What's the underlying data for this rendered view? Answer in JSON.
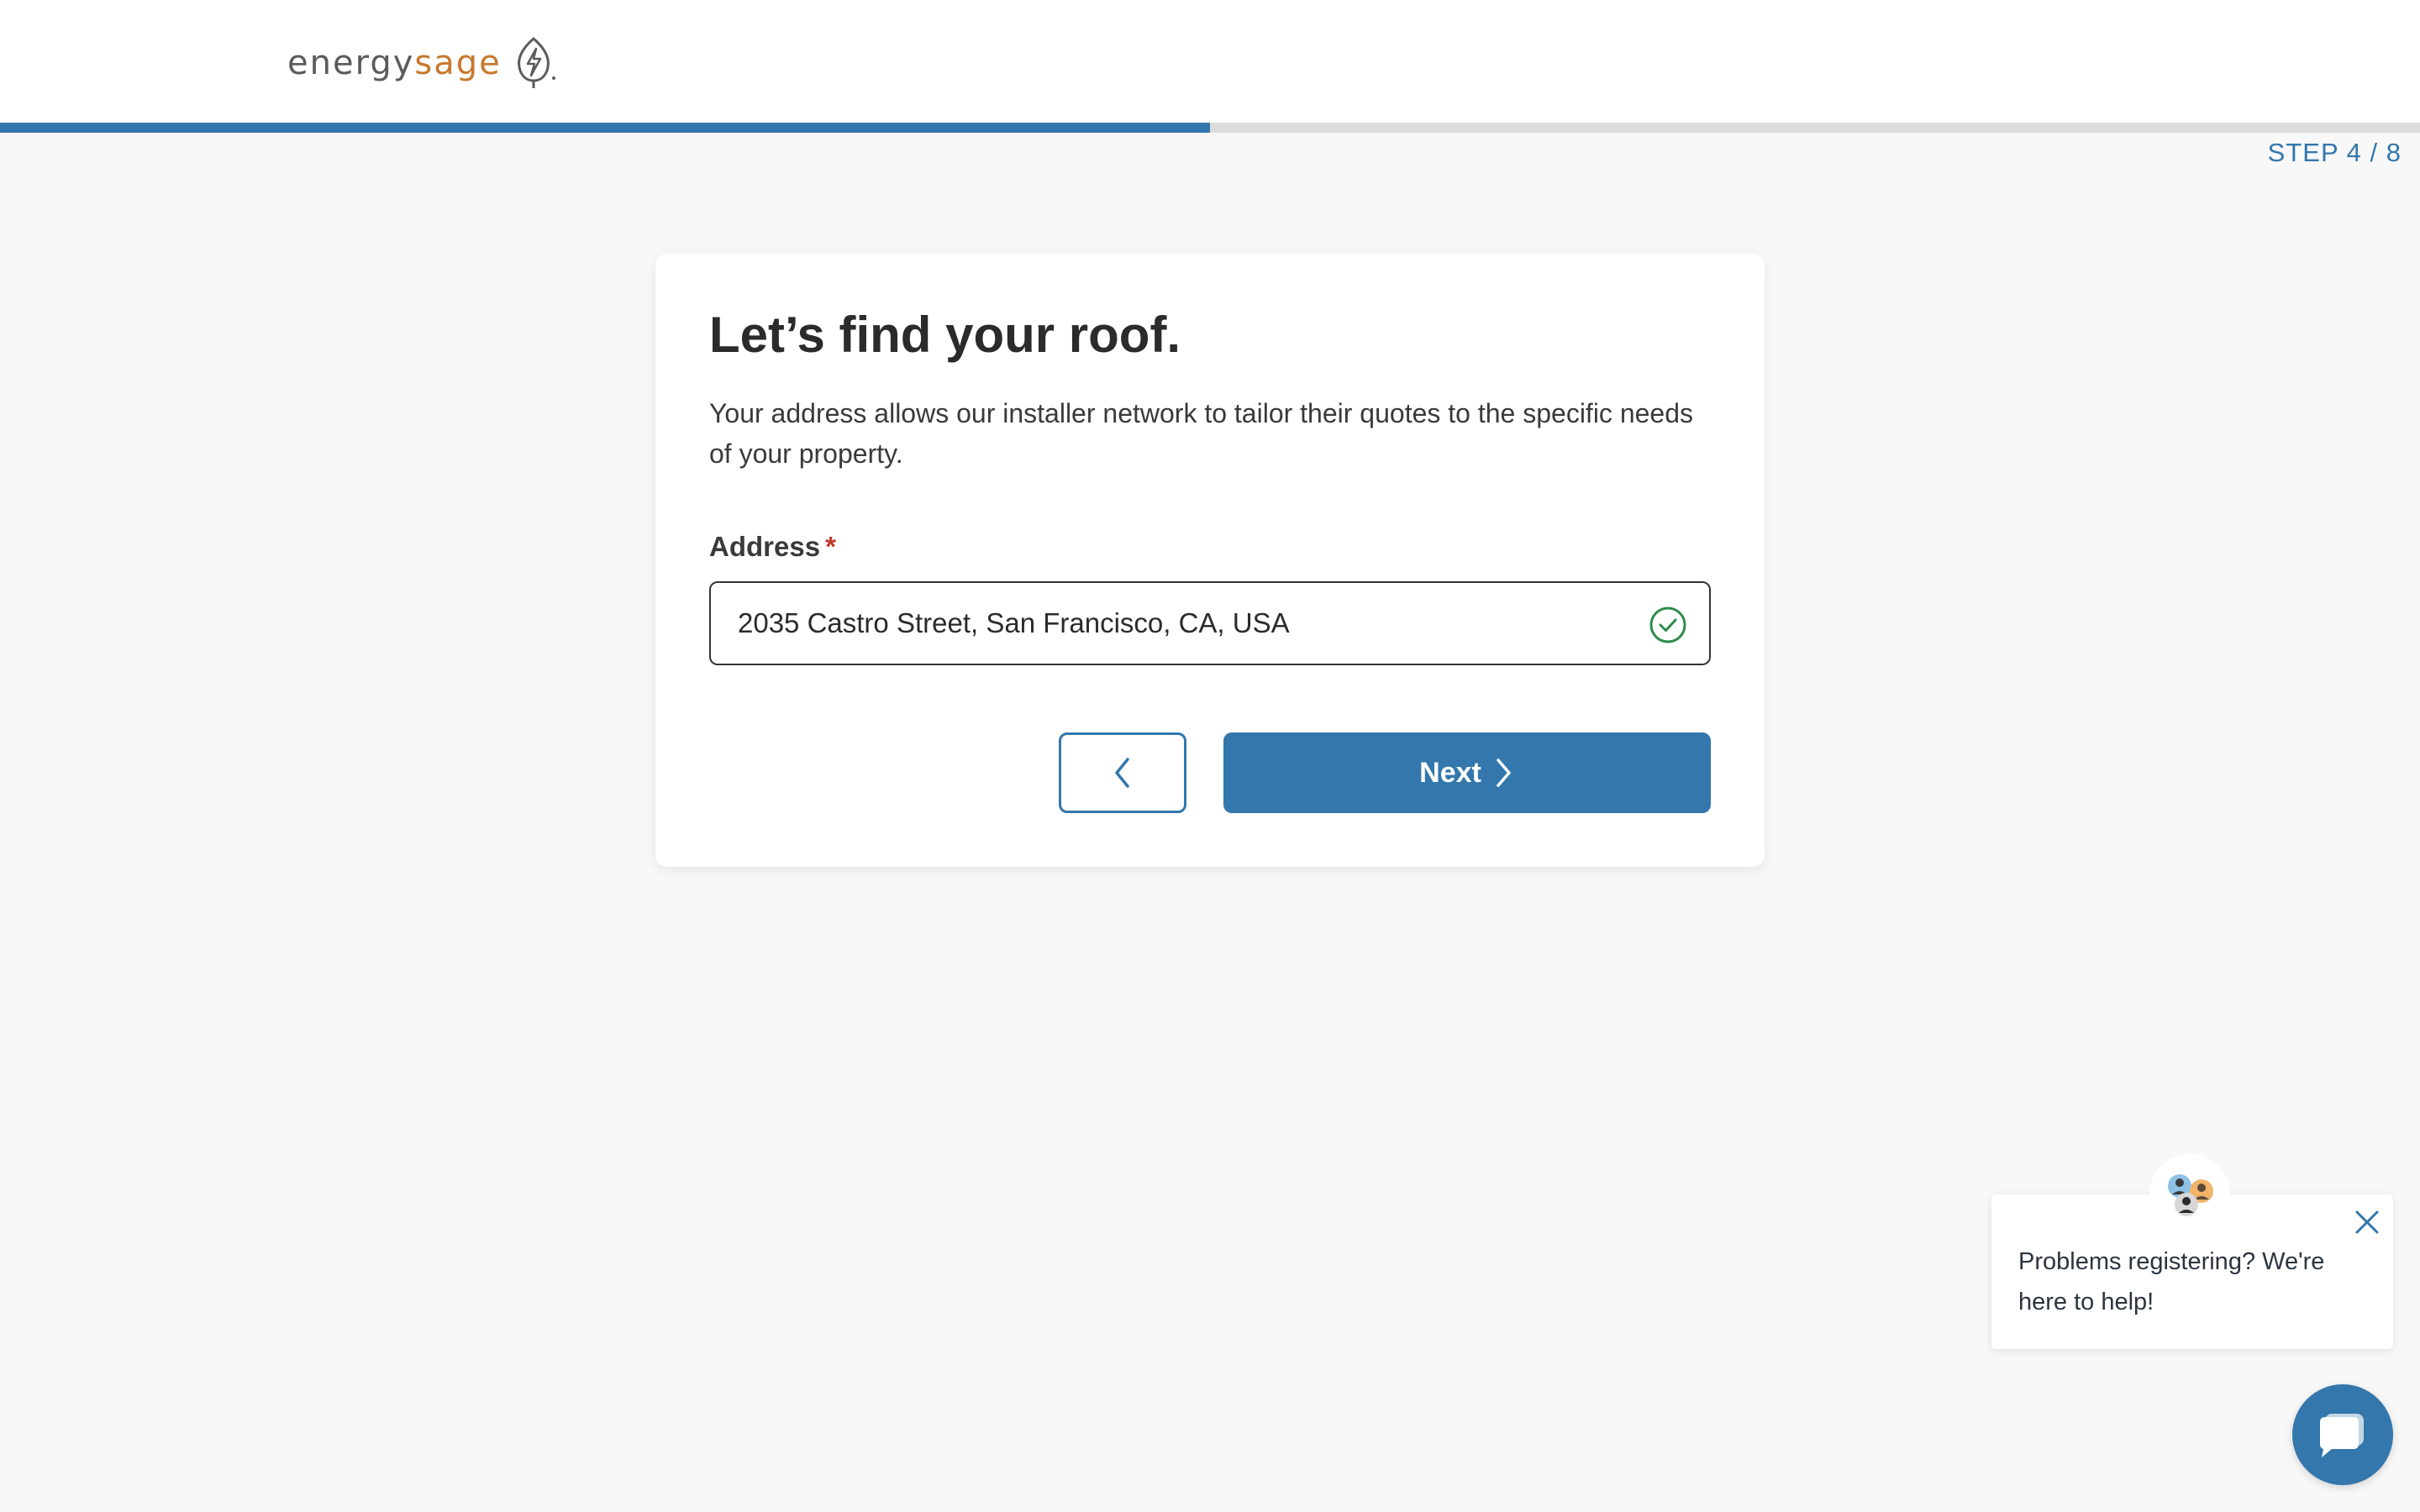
{
  "header": {
    "logo": {
      "part1": "energy",
      "part2": "sage"
    }
  },
  "progress": {
    "fraction": 0.5,
    "step_label": "STEP 4 / 8"
  },
  "card": {
    "title": "Let’s find your roof.",
    "description": "Your address allows our installer network to tailor their quotes to the specific needs of your property.",
    "address_label": "Address",
    "required_marker": "*",
    "address_value": "2035 Castro Street, San Francisco, CA, USA",
    "next_label": "Next"
  },
  "chat": {
    "message": "Problems registering? We're here to help!"
  },
  "icons": {
    "leaf": "leaf-bolt-icon",
    "check": "check-circle-icon",
    "back": "chevron-left-icon",
    "next": "chevron-right-icon",
    "close": "close-icon",
    "chat": "chat-bubble-icon"
  },
  "colors": {
    "accent": "#3377ac",
    "brand_orange": "#c8782e",
    "success": "#2e8b4a",
    "required": "#c0392b"
  }
}
